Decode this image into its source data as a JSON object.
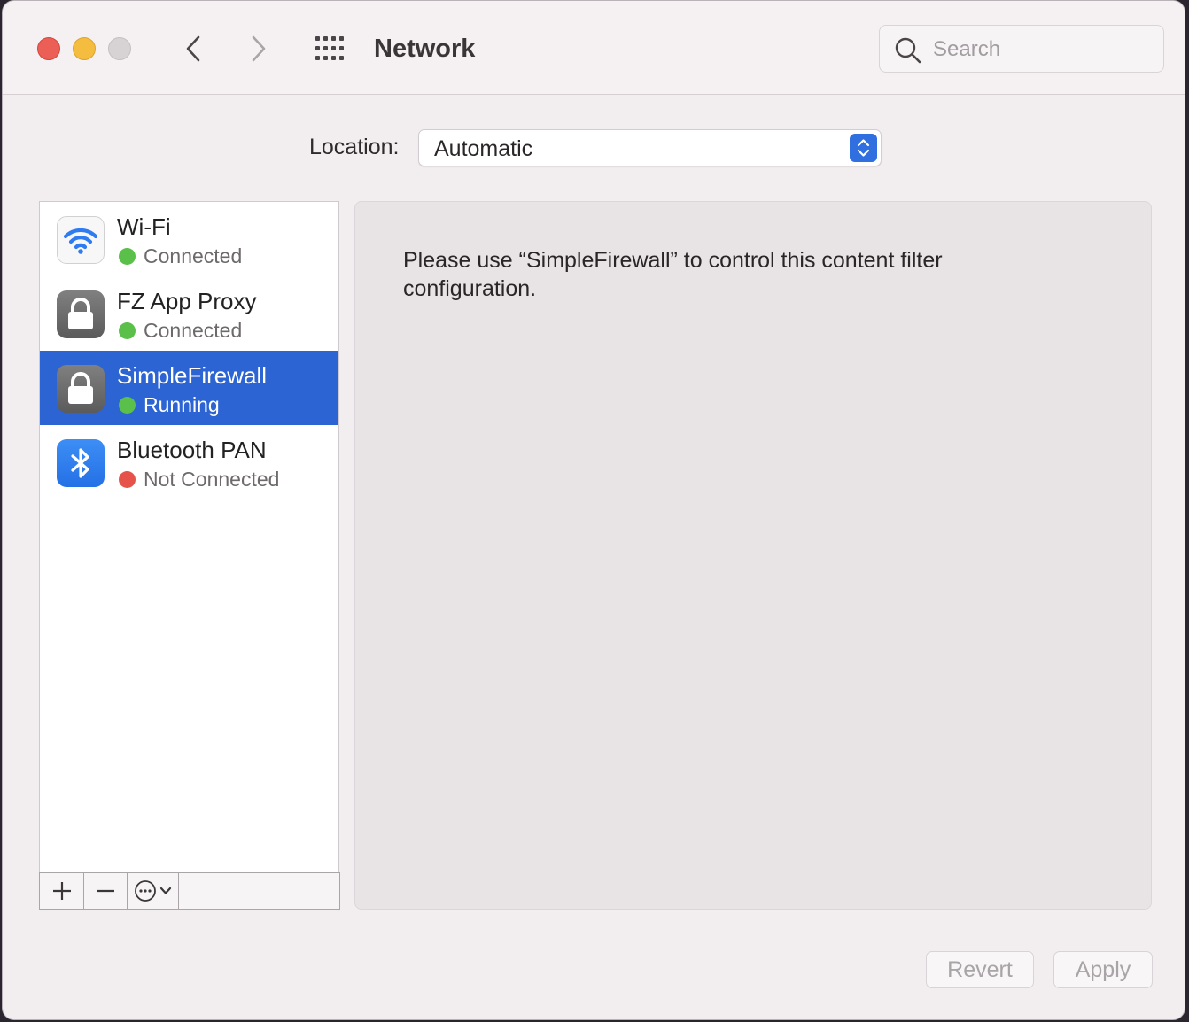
{
  "window": {
    "title": "Network"
  },
  "search": {
    "placeholder": "Search"
  },
  "location": {
    "label": "Location:",
    "value": "Automatic"
  },
  "services": [
    {
      "name": "Wi-Fi",
      "status": "Connected",
      "status_color": "#5ac04a",
      "icon": "wifi-icon",
      "selected": false
    },
    {
      "name": "FZ App Proxy",
      "status": "Connected",
      "status_color": "#5ac04a",
      "icon": "lock-icon",
      "selected": false
    },
    {
      "name": "SimpleFirewall",
      "status": "Running",
      "status_color": "#5ac04a",
      "icon": "lock-icon",
      "selected": true
    },
    {
      "name": "Bluetooth PAN",
      "status": "Not Connected",
      "status_color": "#e5534b",
      "icon": "bluetooth-icon",
      "selected": false
    }
  ],
  "detail": {
    "message": "Please use “SimpleFirewall” to control this content filter configuration."
  },
  "buttons": {
    "revert": "Revert",
    "apply": "Apply"
  },
  "colors": {
    "accent": "#2c64d3",
    "connected": "#5ac04a",
    "disconnected": "#e5534b"
  }
}
